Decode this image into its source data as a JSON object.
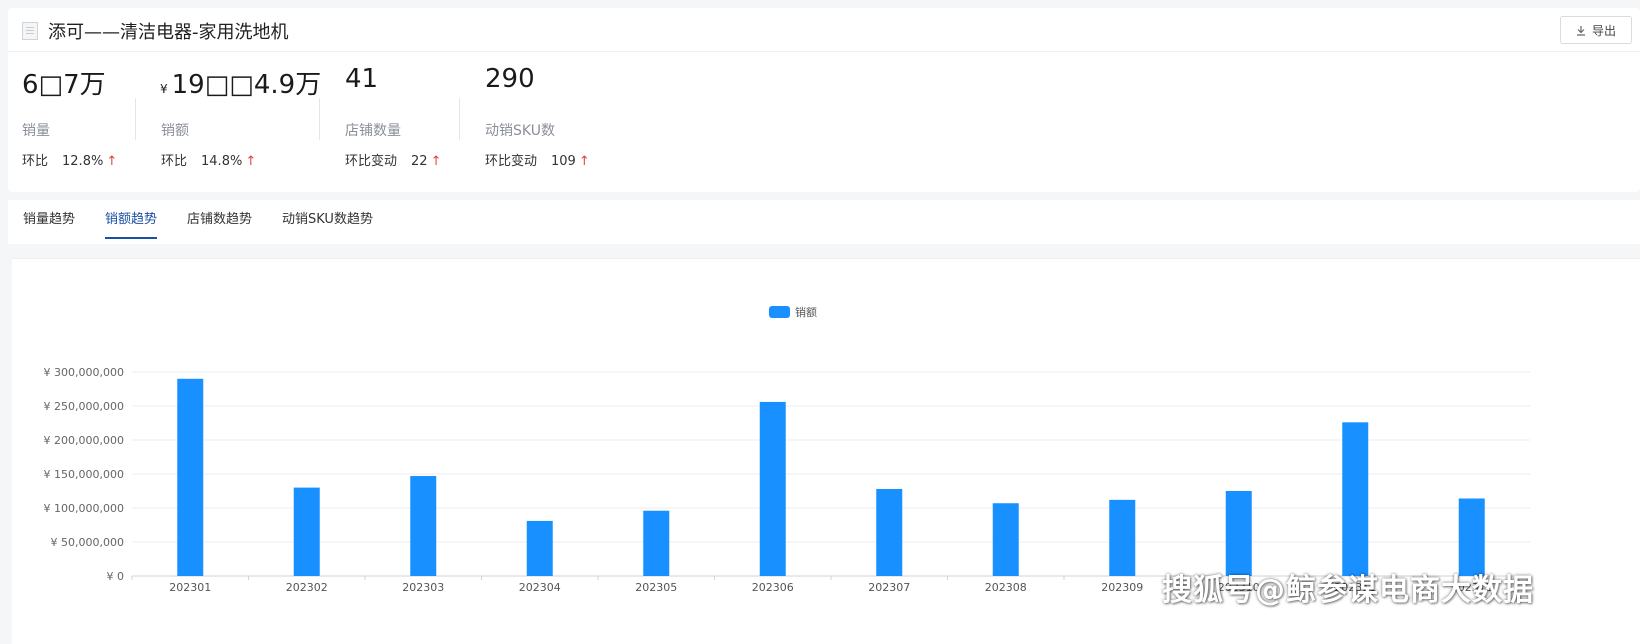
{
  "header": {
    "title": "添可——清洁电器-家用洗地机",
    "export_label": "导出"
  },
  "stats": [
    {
      "value": "6□7万",
      "label": "销量",
      "change_label": "环比",
      "change_value": "12.8%",
      "arrow": "↑"
    },
    {
      "value": "19□□4.9万",
      "currency": "¥",
      "label": "销额",
      "change_label": "环比",
      "change_value": "14.8%",
      "arrow": "↑"
    },
    {
      "value": "41",
      "label": "店铺数量",
      "change_label": "环比变动",
      "change_value": "22",
      "arrow": "↑"
    },
    {
      "value": "290",
      "label": "动销SKU数",
      "change_label": "环比变动",
      "change_value": "109",
      "arrow": "↑"
    }
  ],
  "tabs": [
    {
      "label": "销量趋势",
      "active": false
    },
    {
      "label": "销额趋势",
      "active": true
    },
    {
      "label": "店铺数趋势",
      "active": false
    },
    {
      "label": "动销SKU数趋势",
      "active": false
    }
  ],
  "watermark": "搜狐号@鲸参谋电商大数据",
  "colors": {
    "bar": "#1890ff",
    "active_tab": "#1a4fa3",
    "up_arrow": "#e0443c"
  },
  "chart_data": {
    "type": "bar",
    "legend": [
      "销额"
    ],
    "legend_position": "top-center",
    "categories": [
      "202301",
      "202302",
      "202303",
      "202304",
      "202305",
      "202306",
      "202307",
      "202308",
      "202309",
      "202310",
      "202311",
      "202312"
    ],
    "series": [
      {
        "name": "销额",
        "values": [
          290000000,
          130000000,
          147000000,
          81000000,
          96000000,
          256000000,
          128000000,
          107000000,
          112000000,
          125000000,
          226000000,
          114000000
        ]
      }
    ],
    "ylim": [
      0,
      300000000
    ],
    "yticks": [
      0,
      50000000,
      100000000,
      150000000,
      200000000,
      250000000,
      300000000
    ],
    "ytick_labels": [
      "¥ 0",
      "¥ 50,000,000",
      "¥ 100,000,000",
      "¥ 150,000,000",
      "¥ 200,000,000",
      "¥ 250,000,000",
      "¥ 300,000,000"
    ],
    "grid": true
  }
}
